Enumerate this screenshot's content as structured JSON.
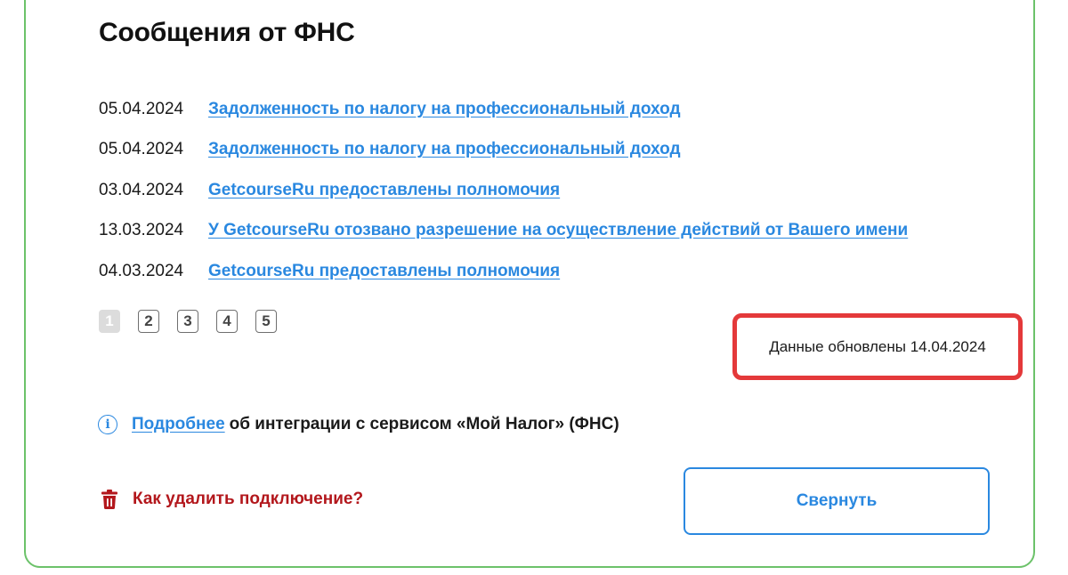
{
  "title": "Сообщения от ФНС",
  "messages": [
    {
      "date": "05.04.2024",
      "text": "Задолженность по налогу на профессиональный доход"
    },
    {
      "date": "05.04.2024",
      "text": "Задолженность по налогу на профессиональный доход"
    },
    {
      "date": "03.04.2024",
      "text": "GetcourseRu предоставлены полномочия"
    },
    {
      "date": "13.03.2024",
      "text": "У GetcourseRu отозвано разрешение на осуществление действий от Вашего имени"
    },
    {
      "date": "04.03.2024",
      "text": "GetcourseRu предоставлены полномочия"
    }
  ],
  "pagination": {
    "pages": [
      "1",
      "2",
      "3",
      "4",
      "5"
    ],
    "current": "1"
  },
  "updated_text": "Данные обновлены 14.04.2024",
  "info": {
    "icon": "info-icon",
    "link_label": "Подробнее",
    "text": "об интеграции с сервисом «Мой Налог» (ФНС)"
  },
  "delete": {
    "icon": "trash-icon",
    "label": "Как удалить подключение?"
  },
  "collapse_label": "Свернуть",
  "colors": {
    "border": "#6cc26a",
    "link": "#2a88e0",
    "highlight": "#e4393a",
    "danger": "#b3171c"
  }
}
